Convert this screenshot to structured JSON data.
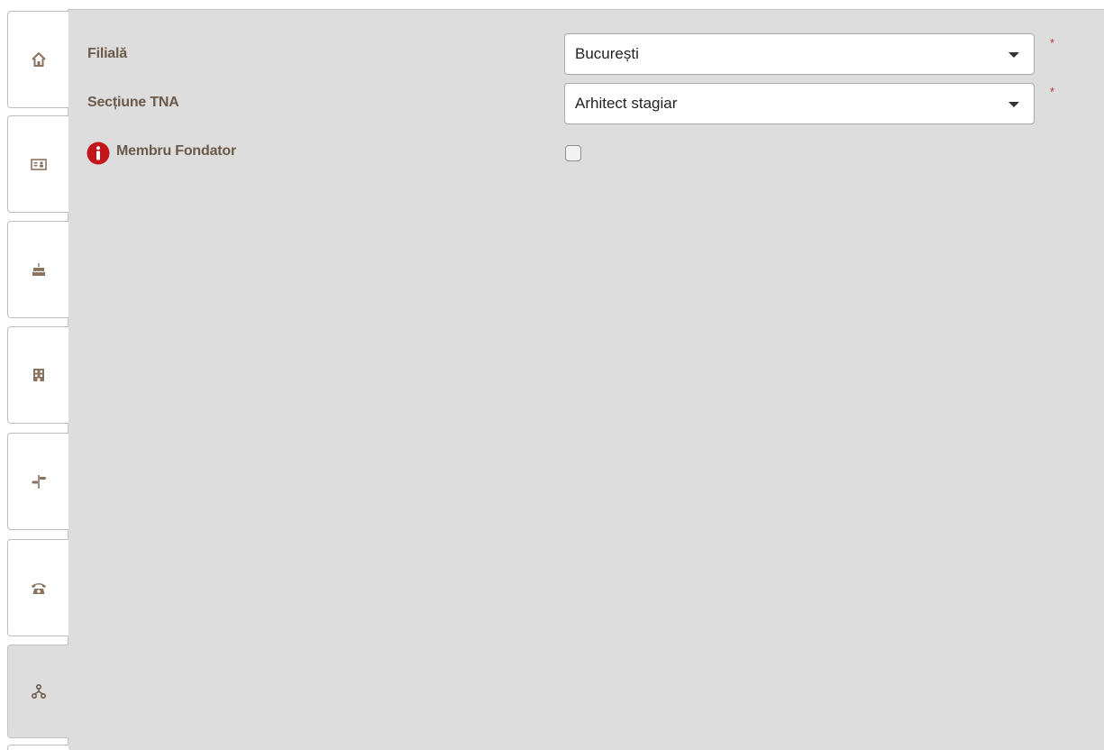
{
  "form": {
    "filiala": {
      "label": "Filială",
      "value": "București",
      "required_mark": "*"
    },
    "sectiune_tna": {
      "label": "Secțiune TNA",
      "value": "Arhitect stagiar",
      "required_mark": "*"
    },
    "membru_fondator": {
      "label": "Membru Fondator",
      "checked": false
    }
  },
  "tabs": [
    {
      "icon": "home-icon"
    },
    {
      "icon": "id-card-icon"
    },
    {
      "icon": "birthday-cake-icon"
    },
    {
      "icon": "building-icon"
    },
    {
      "icon": "signpost-icon"
    },
    {
      "icon": "phone-icon"
    },
    {
      "icon": "sitemap-icon",
      "active": true
    }
  ],
  "colors": {
    "label": "#6b5a4a",
    "icon": "#8a7260",
    "required": "#b5352c",
    "info": "#c3161c",
    "panel": "#dddddd"
  }
}
